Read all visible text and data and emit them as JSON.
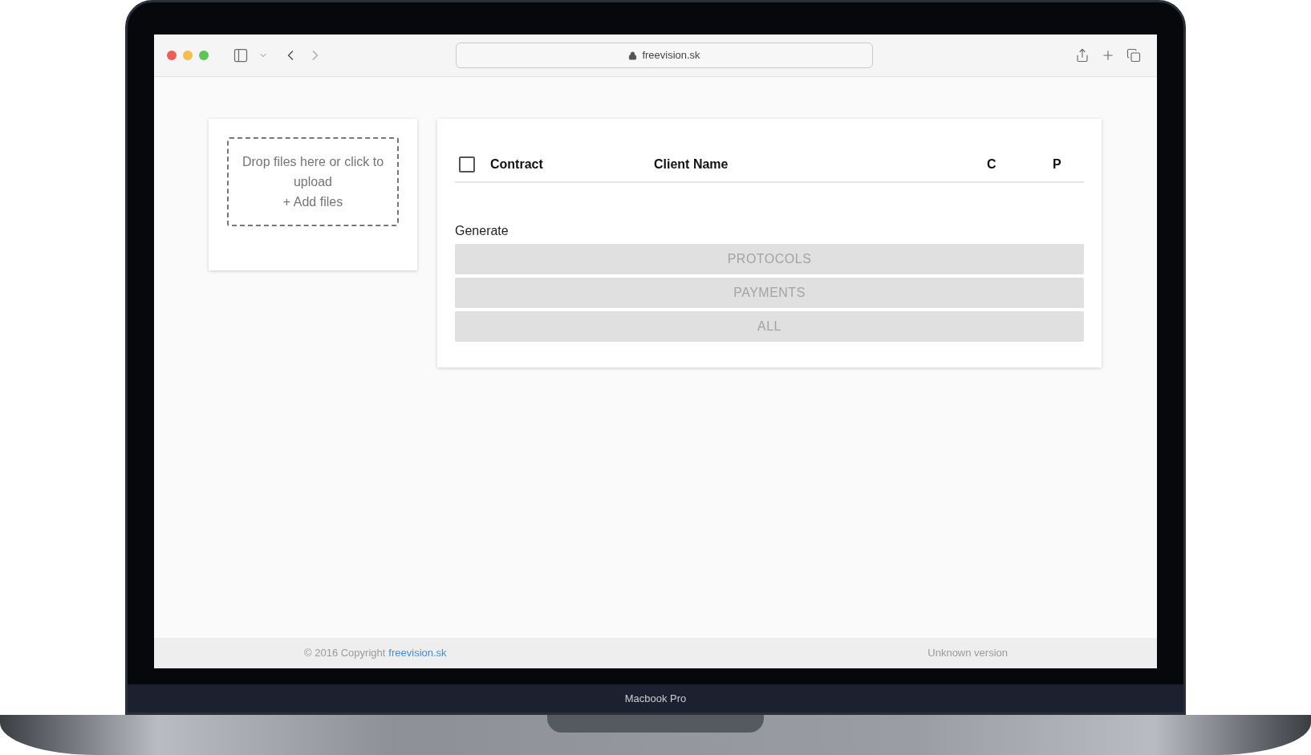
{
  "browser": {
    "url": "freevision.sk"
  },
  "upload": {
    "prompt": "Drop files here or click to upload",
    "action": "+ Add files"
  },
  "table": {
    "select_all": {
      "checked": false
    },
    "columns": [
      "Contract",
      "Client Name",
      "C",
      "P"
    ]
  },
  "generate": {
    "label": "Generate",
    "buttons": [
      {
        "label": "PROTOCOLS",
        "disabled": true
      },
      {
        "label": "PAYMENTS",
        "disabled": true
      },
      {
        "label": "ALL",
        "disabled": true
      }
    ]
  },
  "footer": {
    "copyright": "© 2016 Copyright",
    "link": "freevision.sk",
    "version": "Unknown version"
  },
  "device": {
    "label": "Macbook Pro"
  }
}
